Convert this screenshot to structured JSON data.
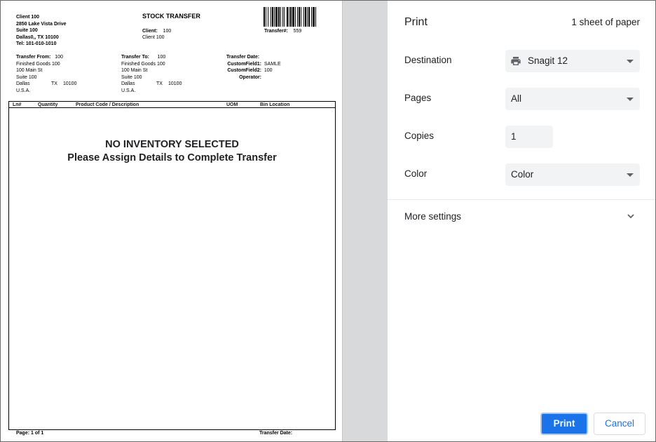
{
  "document": {
    "company_lines": [
      "Client 100",
      "2850 Lake Vista Drive",
      "Suite 100",
      "Dallas0,, TX  10100",
      "Tel:  101-010-1010"
    ],
    "title": "STOCK TRANSFER",
    "client_label": "Client:",
    "client_value": "100",
    "client_name": "Client 100",
    "transfer_num_label": "Transfer#:",
    "transfer_num_value": "559",
    "from": {
      "label": "Transfer From:",
      "code": "100",
      "lines": [
        "Finished Goods 100",
        "100 Main St",
        "Suite 100"
      ],
      "city": "Dallas",
      "state": "TX",
      "zip": "10100",
      "country": "U.S.A."
    },
    "to": {
      "label": "Transfer To:",
      "code": "100",
      "lines": [
        "Finished Goods 100",
        "100 Main St",
        "Suite 100"
      ],
      "city": "Dallas",
      "state": "TX",
      "zip": "10100",
      "country": "U.S.A."
    },
    "meta": {
      "date_label": "Transfer Date:",
      "cf1_label": "CustomField1:",
      "cf1_value": "SAMLE",
      "cf2_label": "CustomField2:",
      "cf2_value": "100",
      "operator_label": "Operator:"
    },
    "table_headers": [
      "Ln#",
      "Quantity",
      "Product Code / Description",
      "UOM",
      "Bin Location"
    ],
    "message_line1": "NO INVENTORY SELECTED",
    "message_line2": "Please Assign Details to Complete Transfer",
    "footer_page": "Page:   1 of   1",
    "footer_date": "Transfer Date:"
  },
  "panel": {
    "title": "Print",
    "sheets": "1 sheet of paper",
    "destination_label": "Destination",
    "destination_value": "Snagit 12",
    "destination_icon": "printer-icon",
    "pages_label": "Pages",
    "pages_value": "All",
    "copies_label": "Copies",
    "copies_value": "1",
    "color_label": "Color",
    "color_value": "Color",
    "more_settings": "More settings",
    "print_button": "Print",
    "cancel_button": "Cancel"
  },
  "colors": {
    "accent": "#1a73e8",
    "field_bg": "#f1f3f4",
    "divider": "#d8d9db"
  }
}
